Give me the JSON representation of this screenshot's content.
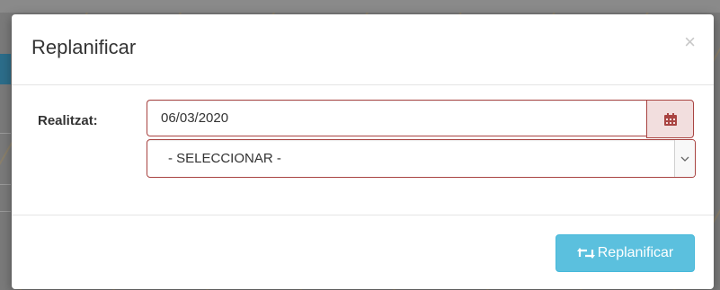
{
  "modal": {
    "title": "Replanificar",
    "close_glyph": "×"
  },
  "form": {
    "date_label": "Realitzat:",
    "date_value": "06/03/2020",
    "calendar_icon": "calendar-icon",
    "select_value": "- SELECCIONAR -"
  },
  "footer": {
    "submit_label": "Replanificar",
    "submit_icon": "retweet-icon"
  },
  "colors": {
    "error_border": "#a94442",
    "error_bg": "#f2dede",
    "info_button": "#5bc0de"
  }
}
